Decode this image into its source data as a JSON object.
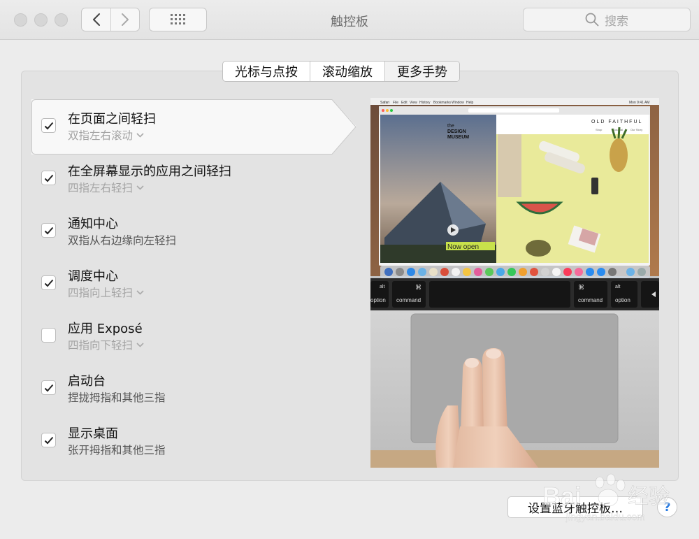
{
  "window": {
    "title": "触控板",
    "search_placeholder": "搜索"
  },
  "tabs": [
    {
      "label": "光标与点按",
      "active": false
    },
    {
      "label": "滚动缩放",
      "active": false
    },
    {
      "label": "更多手势",
      "active": true
    }
  ],
  "gestures": [
    {
      "title": "在页面之间轻扫",
      "subtitle": "双指左右滚动",
      "has_menu": true,
      "checked": true,
      "selected": true
    },
    {
      "title": "在全屏幕显示的应用之间轻扫",
      "subtitle": "四指左右轻扫",
      "has_menu": true,
      "checked": true
    },
    {
      "title": "通知中心",
      "subtitle": "双指从右边缘向左轻扫",
      "has_menu": false,
      "checked": true
    },
    {
      "title": "调度中心",
      "subtitle": "四指向上轻扫",
      "has_menu": true,
      "checked": true
    },
    {
      "title": "应用 Exposé",
      "subtitle": "四指向下轻扫",
      "has_menu": true,
      "checked": false
    },
    {
      "title": "启动台",
      "subtitle": "捏拢拇指和其他三指",
      "has_menu": false,
      "checked": true
    },
    {
      "title": "显示桌面",
      "subtitle": "张开拇指和其他三指",
      "has_menu": false,
      "checked": true
    }
  ],
  "preview": {
    "menubar_items": [
      "Safari",
      "File",
      "Edit",
      "View",
      "History",
      "Bookmarks",
      "Window",
      "Help"
    ],
    "clock": "Mon 9:41 AM",
    "left_page_title_1": "the",
    "left_page_title_2": "DESIGN",
    "left_page_title_3": "MUSEUM",
    "left_page_banner": "Now open",
    "right_page_title": "OLD FAITHFUL",
    "right_page_nav": [
      "Shop",
      "Journal",
      "Our Story"
    ],
    "keys": {
      "left_alt": "alt",
      "left_option": "option",
      "left_cmd_symbol": "⌘",
      "left_command": "command",
      "right_cmd_symbol": "⌘",
      "right_command": "command",
      "right_alt": "alt",
      "right_option": "option"
    }
  },
  "footer": {
    "bluetooth_button": "设置蓝牙触控板…",
    "help": "?"
  },
  "watermark": {
    "text_1": "Bai",
    "text_2": "经验",
    "text_3": "jingyan.baidu.com"
  },
  "colors": {
    "accent_blue": "#2b7de3",
    "background": "#ececec",
    "panel": "#e3e3e3"
  }
}
